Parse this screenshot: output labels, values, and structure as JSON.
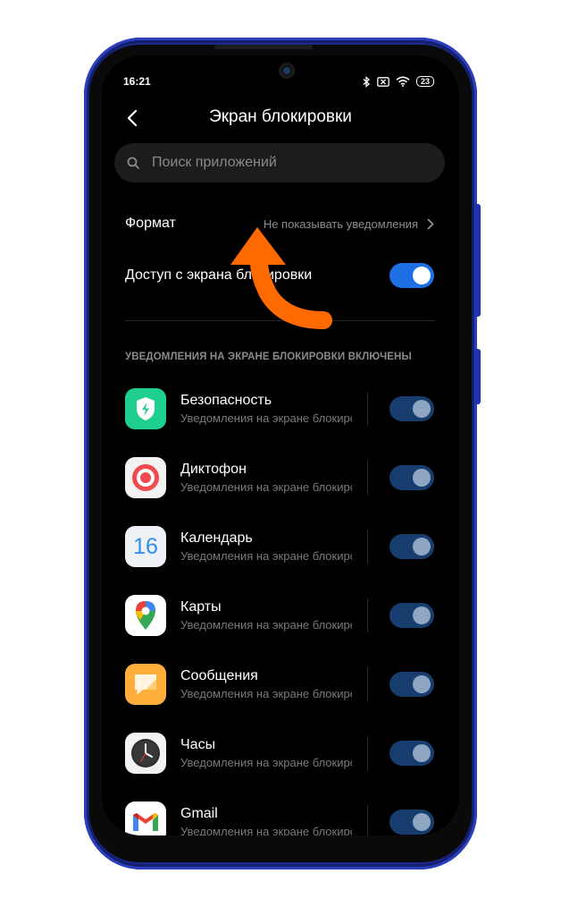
{
  "status_bar": {
    "time": "16:21",
    "battery": "23"
  },
  "header": {
    "title": "Экран блокировки"
  },
  "search": {
    "placeholder": "Поиск приложений"
  },
  "format_row": {
    "label": "Формат",
    "value": "Не показывать уведомления"
  },
  "access_row": {
    "label": "Доступ с экрана блокировки",
    "enabled": true
  },
  "section_title": "УВЕДОМЛЕНИЯ НА ЭКРАНЕ БЛОКИРОВКИ ВКЛЮЧЕНЫ",
  "apps": [
    {
      "name": "Безопасность",
      "subtitle": "Уведомления на экране блокировки",
      "icon": "security-shield-icon",
      "enabled": true
    },
    {
      "name": "Диктофон",
      "subtitle": "Уведомления на экране блокировки",
      "icon": "recorder-icon",
      "enabled": true
    },
    {
      "name": "Календарь",
      "subtitle": "Уведомления на экране блокировки",
      "icon": "calendar-icon",
      "icon_text": "16",
      "enabled": true
    },
    {
      "name": "Карты",
      "subtitle": "Уведомления на экране блокировки",
      "icon": "maps-pin-icon",
      "enabled": true
    },
    {
      "name": "Сообщения",
      "subtitle": "Уведомления на экране блокировки",
      "icon": "messages-icon",
      "enabled": true
    },
    {
      "name": "Часы",
      "subtitle": "Уведомления на экране блокировки",
      "icon": "clock-icon",
      "enabled": true
    },
    {
      "name": "Gmail",
      "subtitle": "Уведомления на экране блокировки",
      "icon": "gmail-icon",
      "enabled": true
    }
  ],
  "colors": {
    "phone_frame": "#1b2a8f",
    "toggle_on": "#1e6fe4",
    "toggle_dim": "#173d6e",
    "annotation_arrow": "#ff6a00"
  }
}
